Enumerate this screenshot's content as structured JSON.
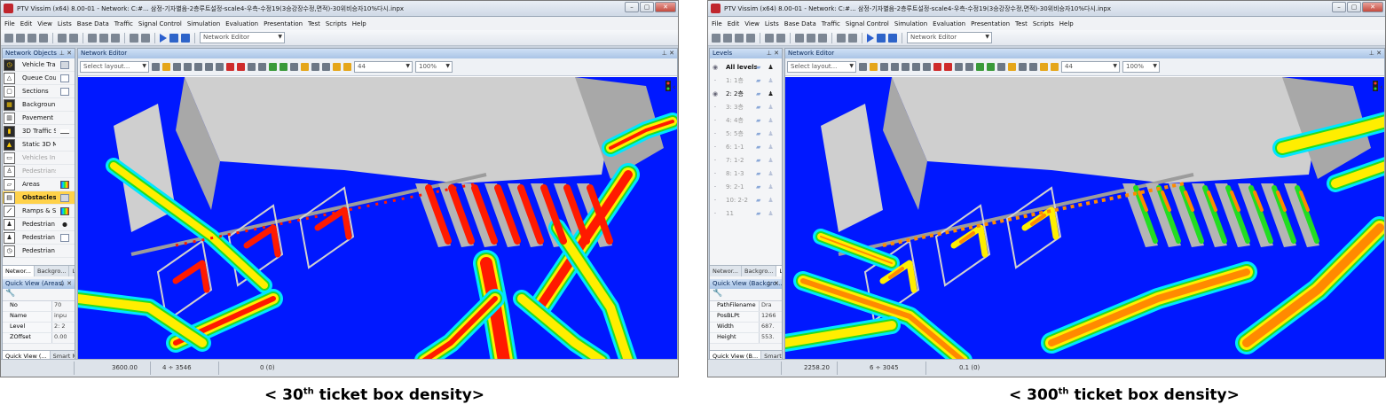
{
  "colors": {
    "ground": "#0018ff",
    "building": "#cfcfcf",
    "building_shade": "#a8a8a8",
    "density_low": "#00e6ff",
    "density_mid": "#22dd22",
    "density_high": "#ffee00",
    "density_peak": "#ff1a00",
    "density_orange": "#ff8a00",
    "panel_select": "#ffd24a"
  },
  "menus": [
    "File",
    "Edit",
    "View",
    "Lists",
    "Base Data",
    "Traffic",
    "Signal Control",
    "Simulation",
    "Evaluation",
    "Presentation",
    "Test",
    "Scripts",
    "Help"
  ],
  "toolbar": {
    "editor_select": "Network Editor"
  },
  "editor": {
    "title": "Network Editor",
    "layout_placeholder": "Select layout...",
    "level_value": "44",
    "zoom_value": "100%"
  },
  "left": {
    "objects_title": "Network Objects",
    "objects": [
      {
        "label": "Vehicle Tra",
        "icon": "vehicle-travel-time-icon",
        "glyph": "◷",
        "dark": true,
        "swatch": "gray"
      },
      {
        "label": "Queue Cou",
        "icon": "queue-counter-icon",
        "glyph": "△",
        "dark": false,
        "swatch": "plain"
      },
      {
        "label": "Sections",
        "icon": "sections-icon",
        "glyph": "▢",
        "dark": false,
        "swatch": "plain"
      },
      {
        "label": "Backgroun",
        "icon": "background-icon",
        "glyph": "▦",
        "dark": true,
        "swatch": "none"
      },
      {
        "label": "Pavement",
        "icon": "pavement-icon",
        "glyph": "▥",
        "dark": false,
        "swatch": "none"
      },
      {
        "label": "3D Traffic S",
        "icon": "traffic-signal-icon",
        "glyph": "▮",
        "dark": true,
        "swatch": "line"
      },
      {
        "label": "Static 3D M",
        "icon": "static-3d-model-icon",
        "glyph": "▲",
        "dark": true,
        "swatch": "none"
      },
      {
        "label": "Vehicles In",
        "icon": "vehicles-in-network-icon",
        "glyph": "▭",
        "dark": false,
        "dim": true,
        "swatch": "none"
      },
      {
        "label": "Pedestrians",
        "icon": "pedestrians-in-network-icon",
        "glyph": "♙",
        "dark": false,
        "dim": true,
        "swatch": "none"
      },
      {
        "label": "Areas",
        "icon": "areas-icon",
        "glyph": "▱",
        "dark": false,
        "swatch": "grad"
      },
      {
        "label": "Obstacles (",
        "icon": "obstacles-icon",
        "glyph": "▤",
        "dark": false,
        "selected": true,
        "bold": true,
        "swatch": "gray"
      },
      {
        "label": "Ramps & St",
        "icon": "ramps-stairs-icon",
        "glyph": "⟋",
        "dark": false,
        "swatch": "grad"
      },
      {
        "label": "Pedestrian I",
        "icon": "pedestrian-input-icon",
        "glyph": "♟",
        "dark": false,
        "swatch": "dot"
      },
      {
        "label": "Pedestrian",
        "icon": "pedestrian-route-icon",
        "glyph": "♟",
        "dark": false,
        "swatch": "plain"
      },
      {
        "label": "Pedestrian",
        "icon": "pedestrian-travel-time-icon",
        "glyph": "◷",
        "dark": false,
        "swatch": "none"
      }
    ],
    "levels_title": "Levels",
    "levels": [
      {
        "name": "All levels",
        "eye": true,
        "bold": true
      },
      {
        "name": "1: 1층",
        "eye": false
      },
      {
        "name": "2: 2층",
        "eye": true,
        "on": true
      },
      {
        "name": "3: 3층",
        "eye": false
      },
      {
        "name": "4: 4층",
        "eye": false
      },
      {
        "name": "5: 5층",
        "eye": false
      },
      {
        "name": "6: 1-1",
        "eye": false
      },
      {
        "name": "7: 1-2",
        "eye": false
      },
      {
        "name": "8: 1-3",
        "eye": false
      },
      {
        "name": "9: 2-1",
        "eye": false
      },
      {
        "name": "10: 2-2",
        "eye": false
      },
      {
        "name": "11",
        "eye": false
      }
    ],
    "tabs_a": [
      "Networ...",
      "Backgro...",
      "Levels"
    ],
    "tabs_b": [
      "Networ...",
      "Backgro...",
      "Levels"
    ],
    "qv_a": {
      "title": "Quick View (Areas)",
      "rows": [
        {
          "key": "No",
          "val": "70"
        },
        {
          "key": "Name",
          "val": "inpu"
        },
        {
          "key": "Level",
          "val": "2: 2"
        },
        {
          "key": "ZOffset",
          "val": "0.00"
        }
      ],
      "tabs": [
        "Quick View (...",
        "Smart Map"
      ]
    },
    "qv_b": {
      "title": "Quick View (Backgro...",
      "rows": [
        {
          "key": "PathFilename",
          "val": "Dra"
        },
        {
          "key": "PosBLPt",
          "val": "1266"
        },
        {
          "key": "Width",
          "val": "687."
        },
        {
          "key": "Height",
          "val": "553."
        }
      ],
      "tabs": [
        "Quick View (B...",
        "Smart Map"
      ]
    }
  },
  "window_a": {
    "title": "PTV Vissim (x64) 8.00-01 - Network: C:#... 삼정-기자별음-2층루트설정-scale4-우측-수정19(3승강장수정,면적)-30위비승자10%다시.inpx",
    "status": {
      "coord": "3600.00",
      "xy": "4 ÷ 3546",
      "sim": "0 (0)"
    }
  },
  "window_b": {
    "title": "PTV Vissim (x64) 8.00-01 - Network: C:#... 삼정-기자별음-2층루트설정-scale4-우측-수정19(3승강장수정,면적)-30위비승자10%다시.inpx",
    "status": {
      "coord": "2258.20",
      "xy": "6 ÷ 3045",
      "sim": "0.1 (0)"
    }
  },
  "captions": {
    "a_pre": "< 30",
    "a_sup": "th",
    "a_post": " ticket box density>",
    "b_pre": "< 300",
    "b_sup": "th",
    "b_post": " ticket box density>"
  }
}
